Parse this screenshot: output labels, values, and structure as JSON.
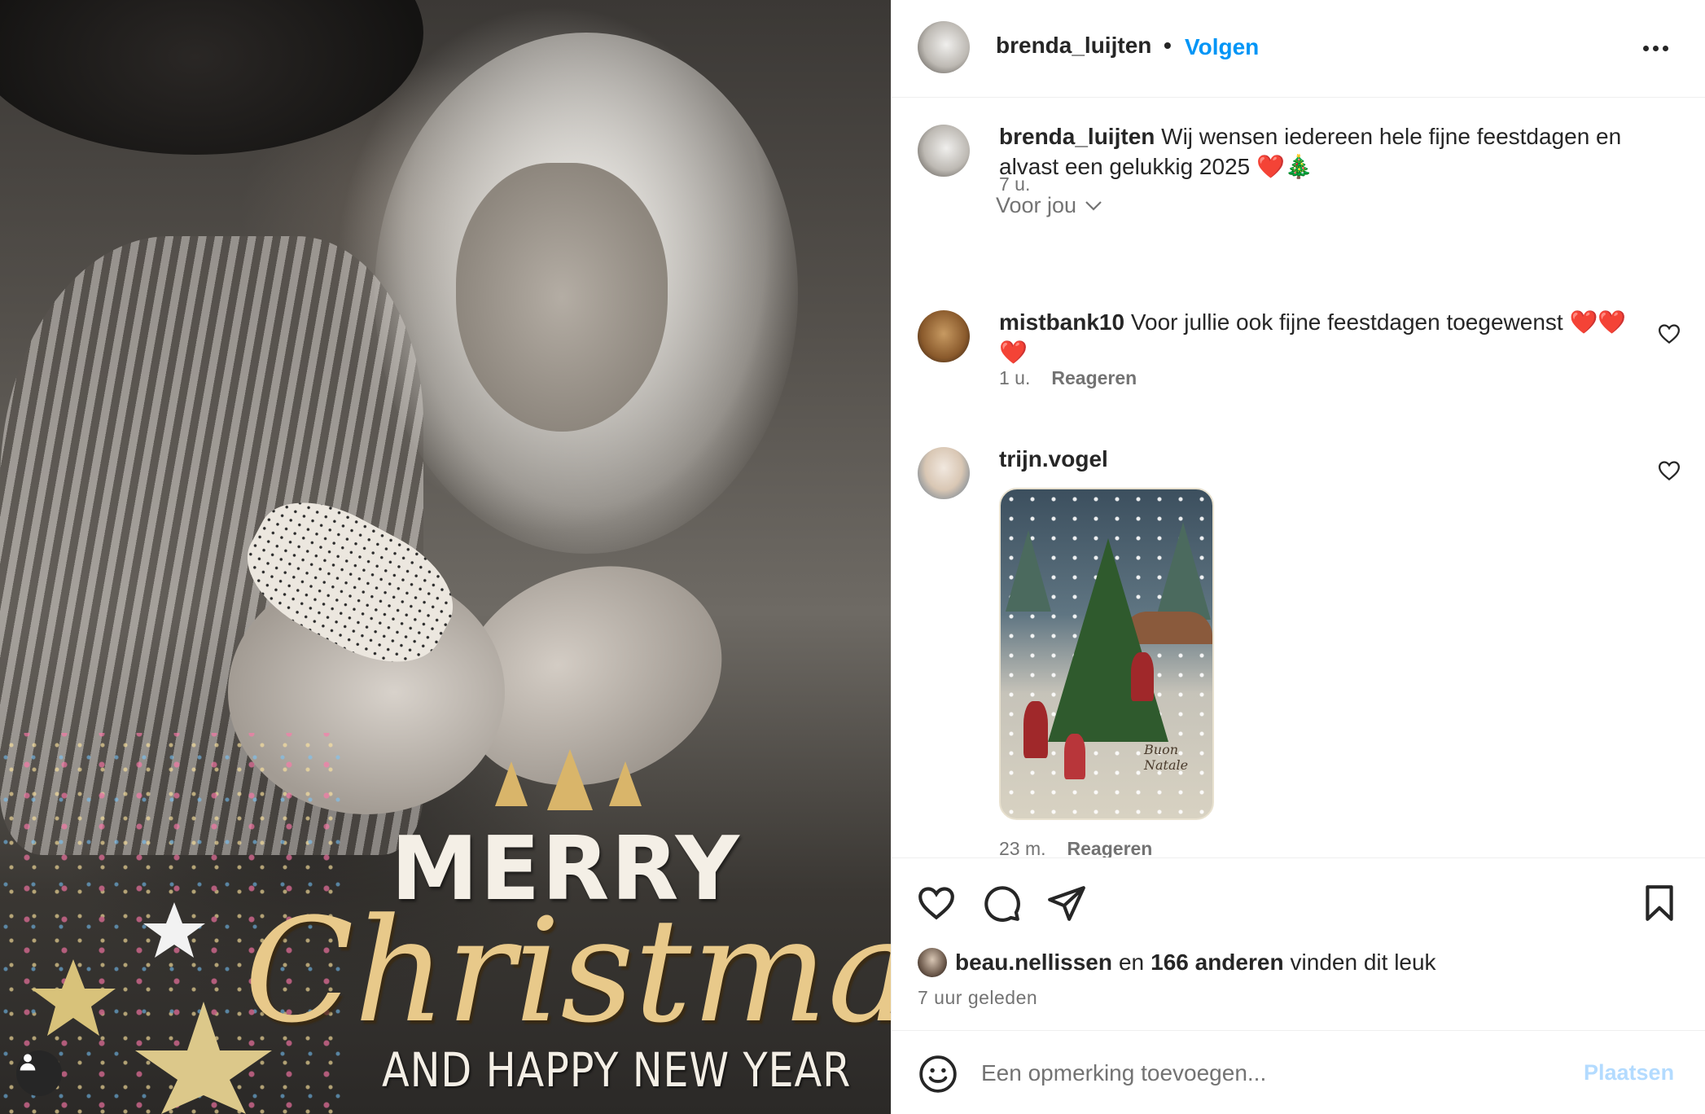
{
  "photo": {
    "card_line1": "MERRY",
    "card_line2": "Christmas",
    "card_line3": "AND HAPPY NEW YEAR"
  },
  "header": {
    "username": "brenda_luijten",
    "separator": "•",
    "follow_label": "Volgen",
    "more_icon": "more-options-icon"
  },
  "caption": {
    "username": "brenda_luijten",
    "text": "Wij wensen iedereen hele fijne feestdagen en alvast een gelukkig 2025 ❤️🎄",
    "time": "7 u."
  },
  "filter": {
    "label": "Voor jou",
    "icon": "chevron-down-icon"
  },
  "comments": [
    {
      "username": "mistbank10",
      "text": "Voor jullie ook fijne feestdagen toegewenst ❤️❤️❤️",
      "time": "1 u.",
      "reply_label": "Reageren"
    },
    {
      "username": "trijn.vogel",
      "image_text": "Buon Natale",
      "time": "23 m.",
      "reply_label": "Reageren"
    }
  ],
  "actions": {
    "like_icon": "heart-icon",
    "comment_icon": "comment-bubble-icon",
    "share_icon": "paper-plane-icon",
    "save_icon": "bookmark-icon"
  },
  "likes": {
    "first_user": "beau.nellissen",
    "connector": "en",
    "others": "166 anderen",
    "suffix": "vinden dit leuk",
    "time_ago": "7 uur geleden"
  },
  "add_comment": {
    "placeholder": "Een opmerking toevoegen...",
    "post_label": "Plaatsen",
    "emoji_icon": "smiley-icon"
  },
  "colors": {
    "accent": "#0095f6",
    "post_disabled": "#b3dbff",
    "text": "#262626",
    "muted": "#737373"
  }
}
